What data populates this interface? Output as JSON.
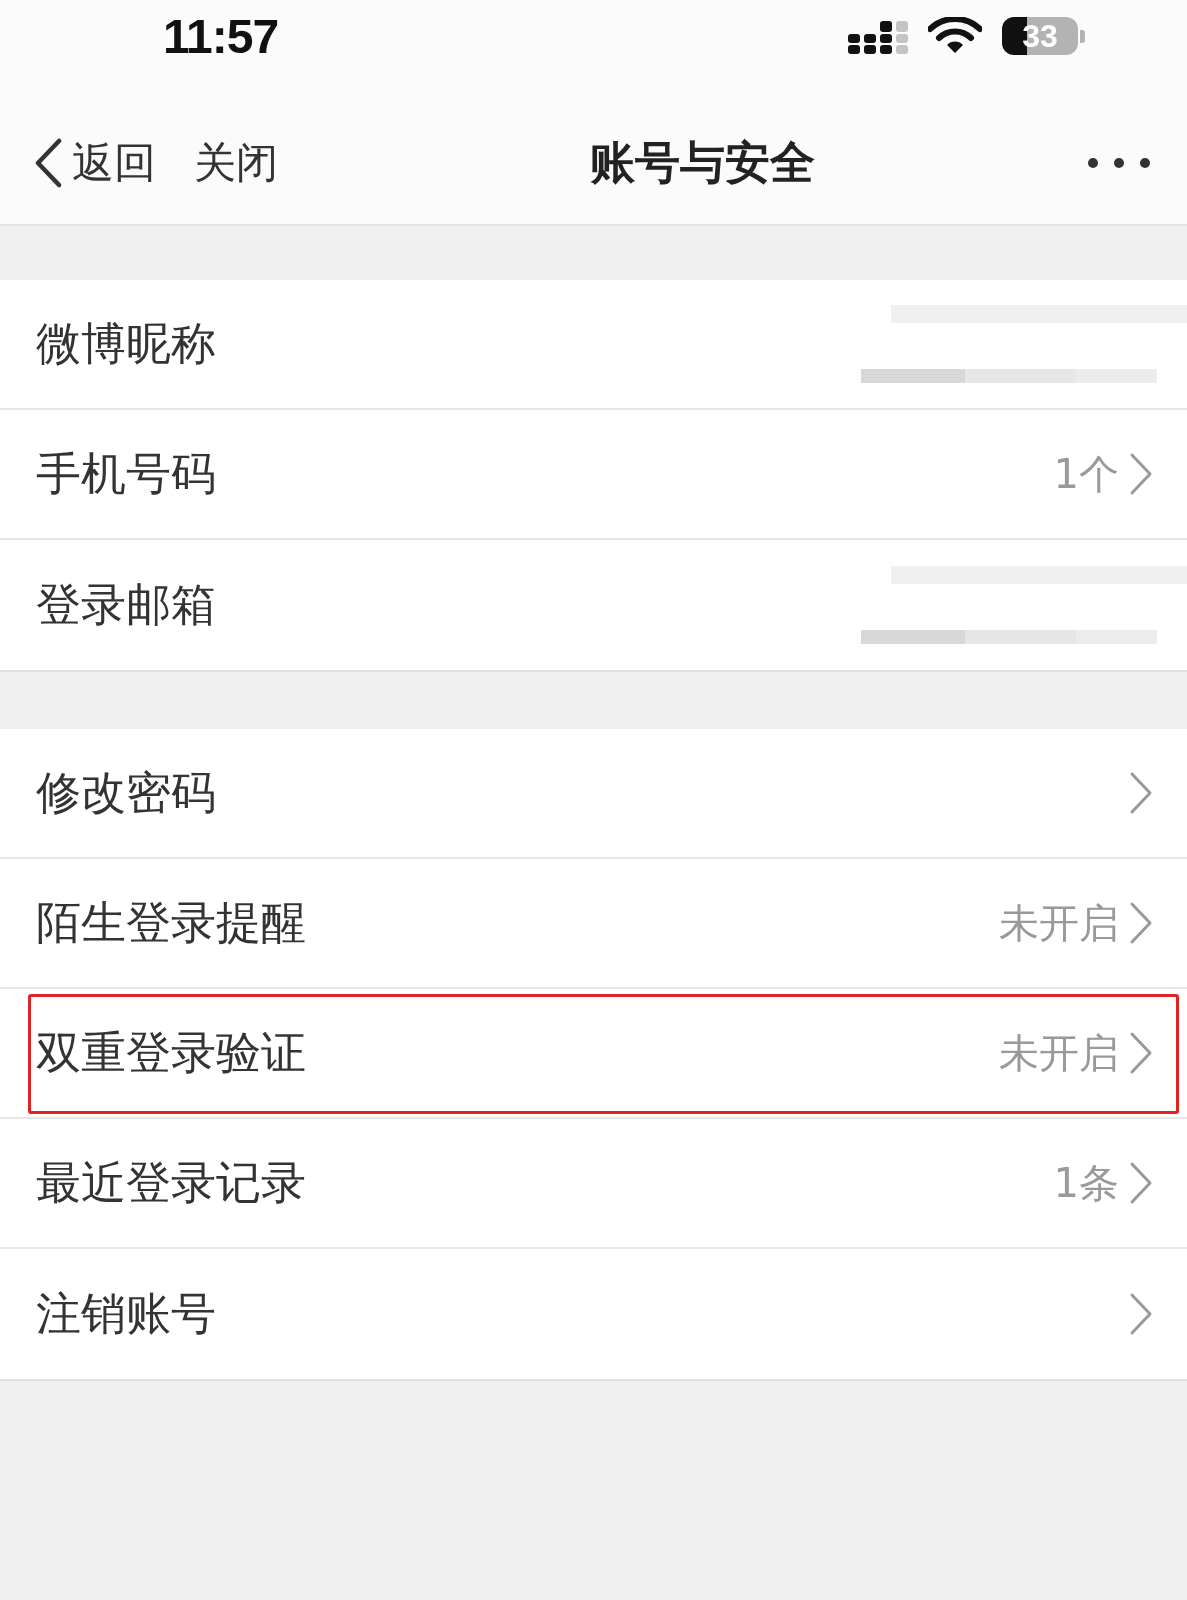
{
  "status_bar": {
    "time": "11:57",
    "battery": "33"
  },
  "nav": {
    "back": "返回",
    "close": "关闭",
    "title": "账号与安全"
  },
  "groups": [
    {
      "rows": [
        {
          "kind": "redacted",
          "label": "微博昵称",
          "highlighted": false
        },
        {
          "kind": "link",
          "label": "手机号码",
          "value": "1个",
          "highlighted": false
        },
        {
          "kind": "redacted",
          "label": "登录邮箱",
          "highlighted": false
        }
      ]
    },
    {
      "rows": [
        {
          "kind": "link",
          "label": "修改密码",
          "highlighted": false
        },
        {
          "kind": "link",
          "label": "陌生登录提醒",
          "value": "未开启",
          "highlighted": false
        },
        {
          "kind": "link",
          "label": "双重登录验证",
          "value": "未开启",
          "highlighted": true
        },
        {
          "kind": "link",
          "label": "最近登录记录",
          "value": "1条",
          "highlighted": false
        },
        {
          "kind": "link",
          "label": "注销账号",
          "highlighted": false
        }
      ]
    }
  ]
}
